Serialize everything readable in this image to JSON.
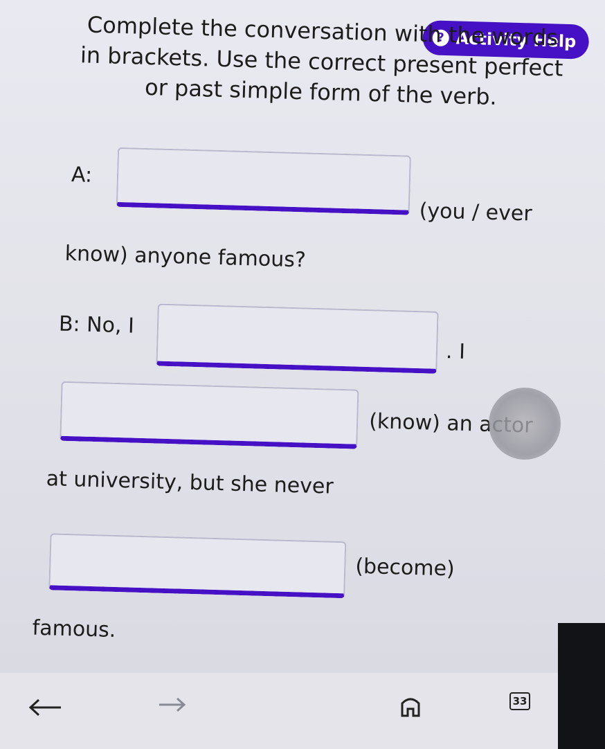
{
  "help": {
    "icon": "question-circle-icon",
    "label": "Activity Help"
  },
  "instructions": {
    "line1": "Complete the conversation with the words",
    "line2": "in brackets. Use the correct present perfect",
    "line3": "or past simple form of the verb."
  },
  "dialogue": {
    "a_label": "A:",
    "a_hint_1": "(you / ever",
    "a_hint_2": "know) anyone famous?",
    "b_label": "B: No, I",
    "b_after_1": ". I",
    "b_hint_2": "(know) an actor",
    "b_text_3": "at university, but she never",
    "b_hint_3": "(become)",
    "b_end": "famous."
  },
  "answers": {
    "blank1": "",
    "blank2": "",
    "blank3": "",
    "blank4": ""
  },
  "nav": {
    "back_icon": "arrow-left-icon",
    "forward_icon": "arrow-right-icon",
    "home_icon": "home-icon",
    "page_number": "33"
  },
  "colors": {
    "accent": "#4611c4",
    "text": "#1c1c1c",
    "background": "#e6e7ee"
  }
}
